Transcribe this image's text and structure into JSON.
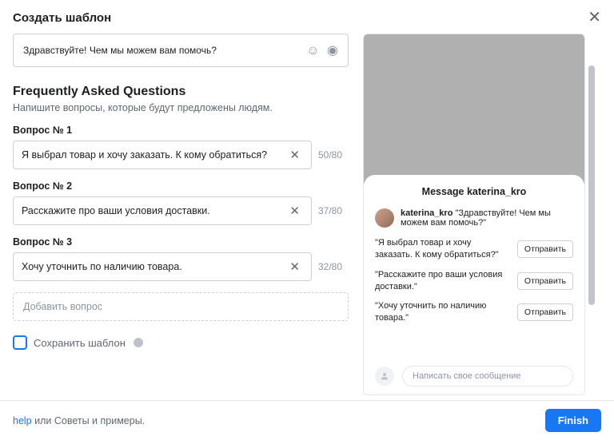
{
  "header": {
    "title": "Создать шаблон"
  },
  "greeting": "Здравствуйте! Чем мы можем вам помочь?",
  "faq": {
    "heading": "Frequently Asked Questions",
    "subheading": "Напишите вопросы, которые будут предложены людям.",
    "questions": [
      {
        "label": "Вопрос № 1",
        "text": "Я выбрал товар и хочу заказать. К кому обратиться?",
        "counter": "50/80"
      },
      {
        "label": "Вопрос № 2",
        "text": "Расскажите про ваши условия доставки.",
        "counter": "37/80"
      },
      {
        "label": "Вопрос № 3",
        "text": "Хочу уточнить по наличию товара.",
        "counter": "32/80"
      }
    ],
    "add_label": "Добавить вопрос"
  },
  "save_template_label": "Сохранить шаблон",
  "preview": {
    "title": "Message katerina_kro",
    "username": "katerina_kro",
    "greeting_quoted": "\"Здравствуйте! Чем мы можем вам помочь?\"",
    "items": [
      {
        "text": "\"Я выбрал товар и хочу заказать. К кому обратиться?\""
      },
      {
        "text": "\"Расскажите про ваши условия доставки.\""
      },
      {
        "text": "\"Хочу уточнить по наличию товара.\""
      }
    ],
    "send_label": "Отправить",
    "compose_placeholder": "Написать свое сообщение"
  },
  "footer": {
    "help_link": "help",
    "rest": " или Советы и примеры.",
    "finish": "Finish"
  }
}
